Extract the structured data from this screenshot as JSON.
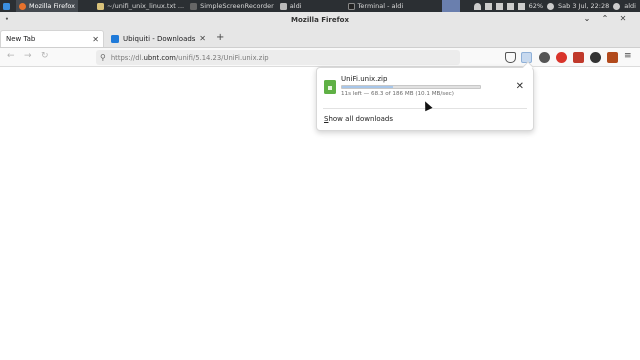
{
  "taskbar": {
    "items": [
      {
        "label": "Mozilla Firefox",
        "active": true
      },
      {
        "label": "~/unifi_unix_linux.txt ...",
        "active": false
      },
      {
        "label": "SimpleScreenRecorder",
        "active": false
      },
      {
        "label": "aldi",
        "active": false
      },
      {
        "label": "Terminal - aldi",
        "active": false
      }
    ],
    "battery": "62%",
    "clock": "Sab  3 Jul, 22:28",
    "user": "aldi"
  },
  "window": {
    "title": "Mozilla Firefox"
  },
  "tabs": [
    {
      "label": "New Tab",
      "selected": true
    },
    {
      "label": "Ubiquiti - Downloads",
      "selected": false
    }
  ],
  "urlbar": {
    "prefix": "https://dl.",
    "host": "ubnt.com",
    "path": "/unifi/5.14.23/UniFi.unix.zip"
  },
  "downloads": {
    "filename": "UniFi.unix.zip",
    "progress_fraction": 0.37,
    "status": "11s left — 68.3 of 186 MB (10.1 MB/sec)",
    "show_all_prefix": "S",
    "show_all_rest": "how all downloads"
  },
  "colors": {
    "accent": "#1f7ad9",
    "zip_icon": "#5fb045",
    "progress_fill": "#a8c7ea"
  }
}
